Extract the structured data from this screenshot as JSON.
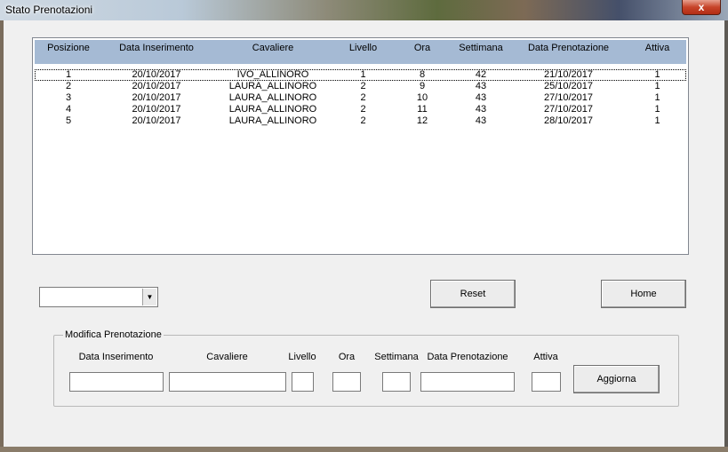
{
  "window": {
    "title": "Stato Prenotazioni",
    "close_glyph": "x"
  },
  "list": {
    "columns": [
      "Posizione",
      "Data Inserimento",
      "Cavaliere",
      "Livello",
      "Ora",
      "Settimana",
      "Data Prenotazione",
      "Attiva"
    ],
    "rows": [
      [
        "1",
        "20/10/2017",
        "IVO_ALLINORO",
        "1",
        "8",
        "42",
        "21/10/2017",
        "1"
      ],
      [
        "2",
        "20/10/2017",
        "LAURA_ALLINORO",
        "2",
        "9",
        "43",
        "25/10/2017",
        "1"
      ],
      [
        "3",
        "20/10/2017",
        "LAURA_ALLINORO",
        "2",
        "10",
        "43",
        "27/10/2017",
        "1"
      ],
      [
        "4",
        "20/10/2017",
        "LAURA_ALLINORO",
        "2",
        "11",
        "43",
        "27/10/2017",
        "1"
      ],
      [
        "5",
        "20/10/2017",
        "LAURA_ALLINORO",
        "2",
        "12",
        "43",
        "28/10/2017",
        "1"
      ]
    ]
  },
  "controls": {
    "combo_value": "",
    "combo_icon": "dropdown-arrow-icon",
    "reset_label": "Reset",
    "home_label": "Home"
  },
  "edit": {
    "group_title": "Modifica Prenotazione",
    "labels": {
      "data_inserimento": "Data Inserimento",
      "cavaliere": "Cavaliere",
      "livello": "Livello",
      "ora": "Ora",
      "settimana": "Settimana",
      "data_prenotazione": "Data Prenotazione",
      "attiva": "Attiva"
    },
    "update_label": "Aggiorna"
  }
}
